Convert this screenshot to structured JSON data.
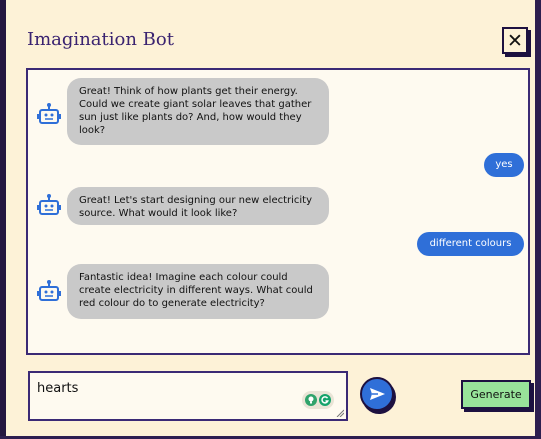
{
  "window": {
    "title": "Imagination Bot",
    "close_label": "✕"
  },
  "messages": [
    {
      "sender": "bot",
      "text": "Great! Think of how plants get their energy. Could we create giant solar leaves that gather sun just like plants do? And, how would they look?"
    },
    {
      "sender": "user",
      "text": "yes"
    },
    {
      "sender": "bot",
      "text": "Great! Let's start designing our new electricity source. What would it look like?"
    },
    {
      "sender": "user",
      "text": "different colours"
    },
    {
      "sender": "bot",
      "text": "Fantastic idea! Imagine each colour could create electricity in different ways. What could red colour do to generate electricity?"
    }
  ],
  "composer": {
    "value": "hearts",
    "send_icon": "send-arrow-icon",
    "generate_label": "Generate"
  },
  "colors": {
    "accent": "#2f6fd8",
    "frame": "#2d1e4f",
    "background": "#fdf2d7",
    "bot_bubble": "#c9c9c9",
    "generate": "#98e39a"
  }
}
